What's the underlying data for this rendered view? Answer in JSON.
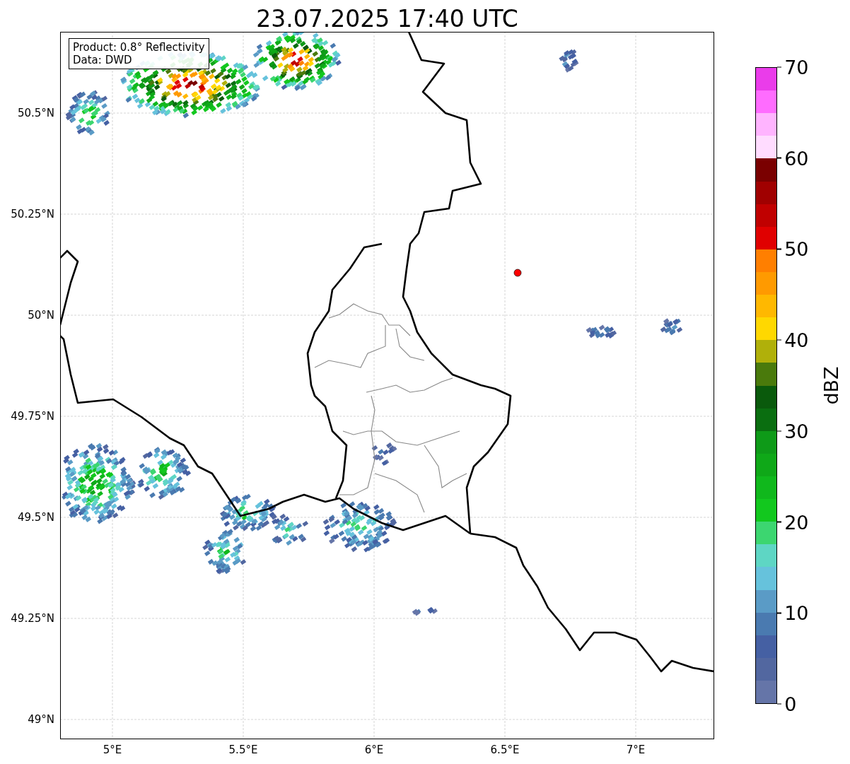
{
  "title": "23.07.2025 17:40 UTC",
  "info_box": {
    "lines": [
      "Product: 0.8° Reflectivity",
      "Data: DWD"
    ]
  },
  "lat_ticks": [
    "50.5°N",
    "50.25°N",
    "50°N",
    "49.75°N",
    "49.5°N",
    "49.25°N",
    "49°N"
  ],
  "lon_ticks": [
    "5°E",
    "5.5°E",
    "6°E",
    "6.5°E",
    "7°E"
  ],
  "colorbar": {
    "label": "dBZ",
    "ticks": [
      "70",
      "60",
      "50",
      "40",
      "30",
      "20",
      "10",
      "0"
    ],
    "bins": [
      {
        "color": "#ea3cea"
      },
      {
        "color": "#ff6cff"
      },
      {
        "color": "#ffb4ff"
      },
      {
        "color": "#ffdcff"
      },
      {
        "color": "#7a0000"
      },
      {
        "color": "#a00000"
      },
      {
        "color": "#c00000"
      },
      {
        "color": "#e00000"
      },
      {
        "color": "#ff7f00"
      },
      {
        "color": "#ff9a00"
      },
      {
        "color": "#ffb800"
      },
      {
        "color": "#ffd800"
      },
      {
        "color": "#b0b00a"
      },
      {
        "color": "#4a7a0c"
      },
      {
        "color": "#0a5a0c"
      },
      {
        "color": "#0a6e10"
      },
      {
        "color": "#0e9a18"
      },
      {
        "color": "#0fa818"
      },
      {
        "color": "#10b81c"
      },
      {
        "color": "#12c81e"
      },
      {
        "color": "#3cd670"
      },
      {
        "color": "#5ed6c4"
      },
      {
        "color": "#66c2dc"
      },
      {
        "color": "#5a9bc6"
      },
      {
        "color": "#4a7ab0"
      },
      {
        "color": "#4560a3"
      },
      {
        "color": "#5267a0"
      },
      {
        "color": "#6575a8"
      }
    ]
  }
}
